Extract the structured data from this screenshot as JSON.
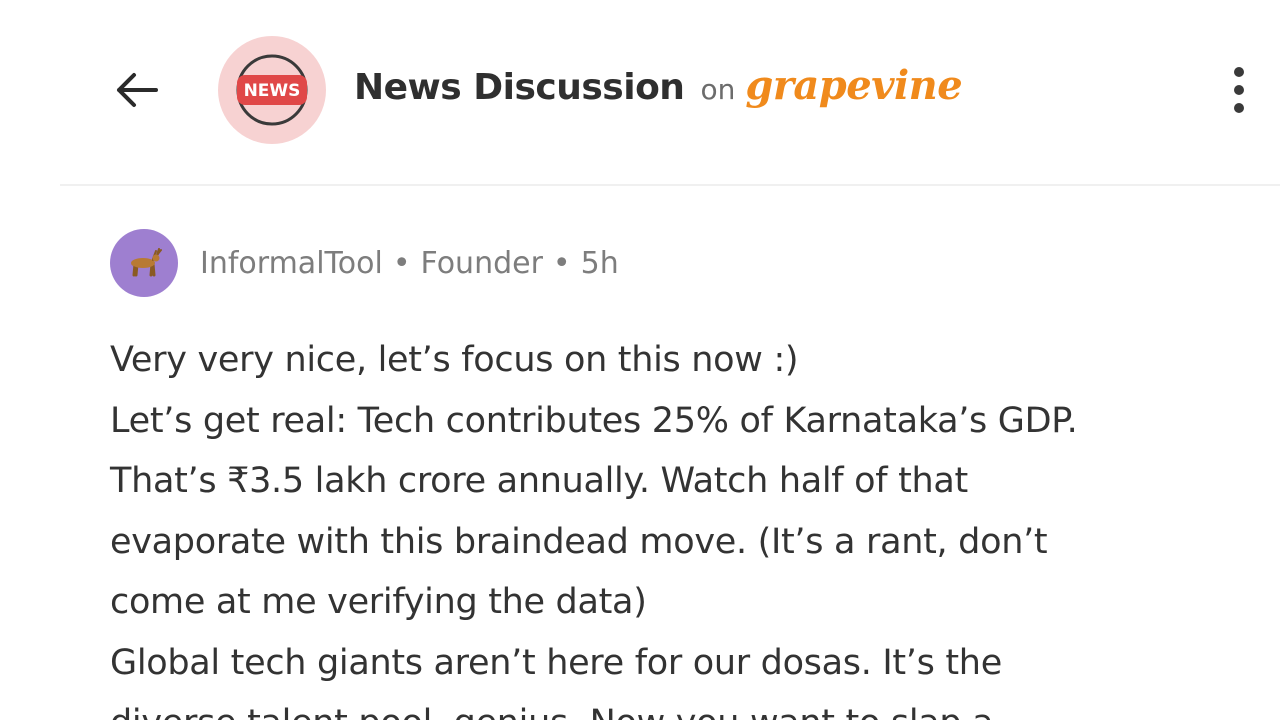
{
  "header": {
    "back_icon": "arrow-left-icon",
    "channel_badge": "NEWS",
    "channel_title": "News Discussion",
    "on_label": "on",
    "brand": "grapevine",
    "more_icon": "more-vertical-icon"
  },
  "post": {
    "author": "InformalTool",
    "role": "Founder",
    "time": "5h",
    "separator": "•",
    "lines": [
      "Very very nice, let’s focus on this now :)",
      "Let’s get real: Tech contributes 25% of Karnataka’s GDP.",
      "That’s ₹3.5 lakh crore annually. Watch half of that",
      "evaporate with this braindead move. (It’s a rant, don’t",
      "come at me verifying the data)",
      "Global tech giants aren’t here for our dosas. It’s the",
      "diverse talent pool, genius. Now you want to slap a"
    ]
  },
  "colors": {
    "brand": "#f08a1c",
    "news_badge": "#e04848",
    "channel_avatar_bg": "#f7d2d2",
    "user_avatar_bg": "#9e7fd0"
  }
}
